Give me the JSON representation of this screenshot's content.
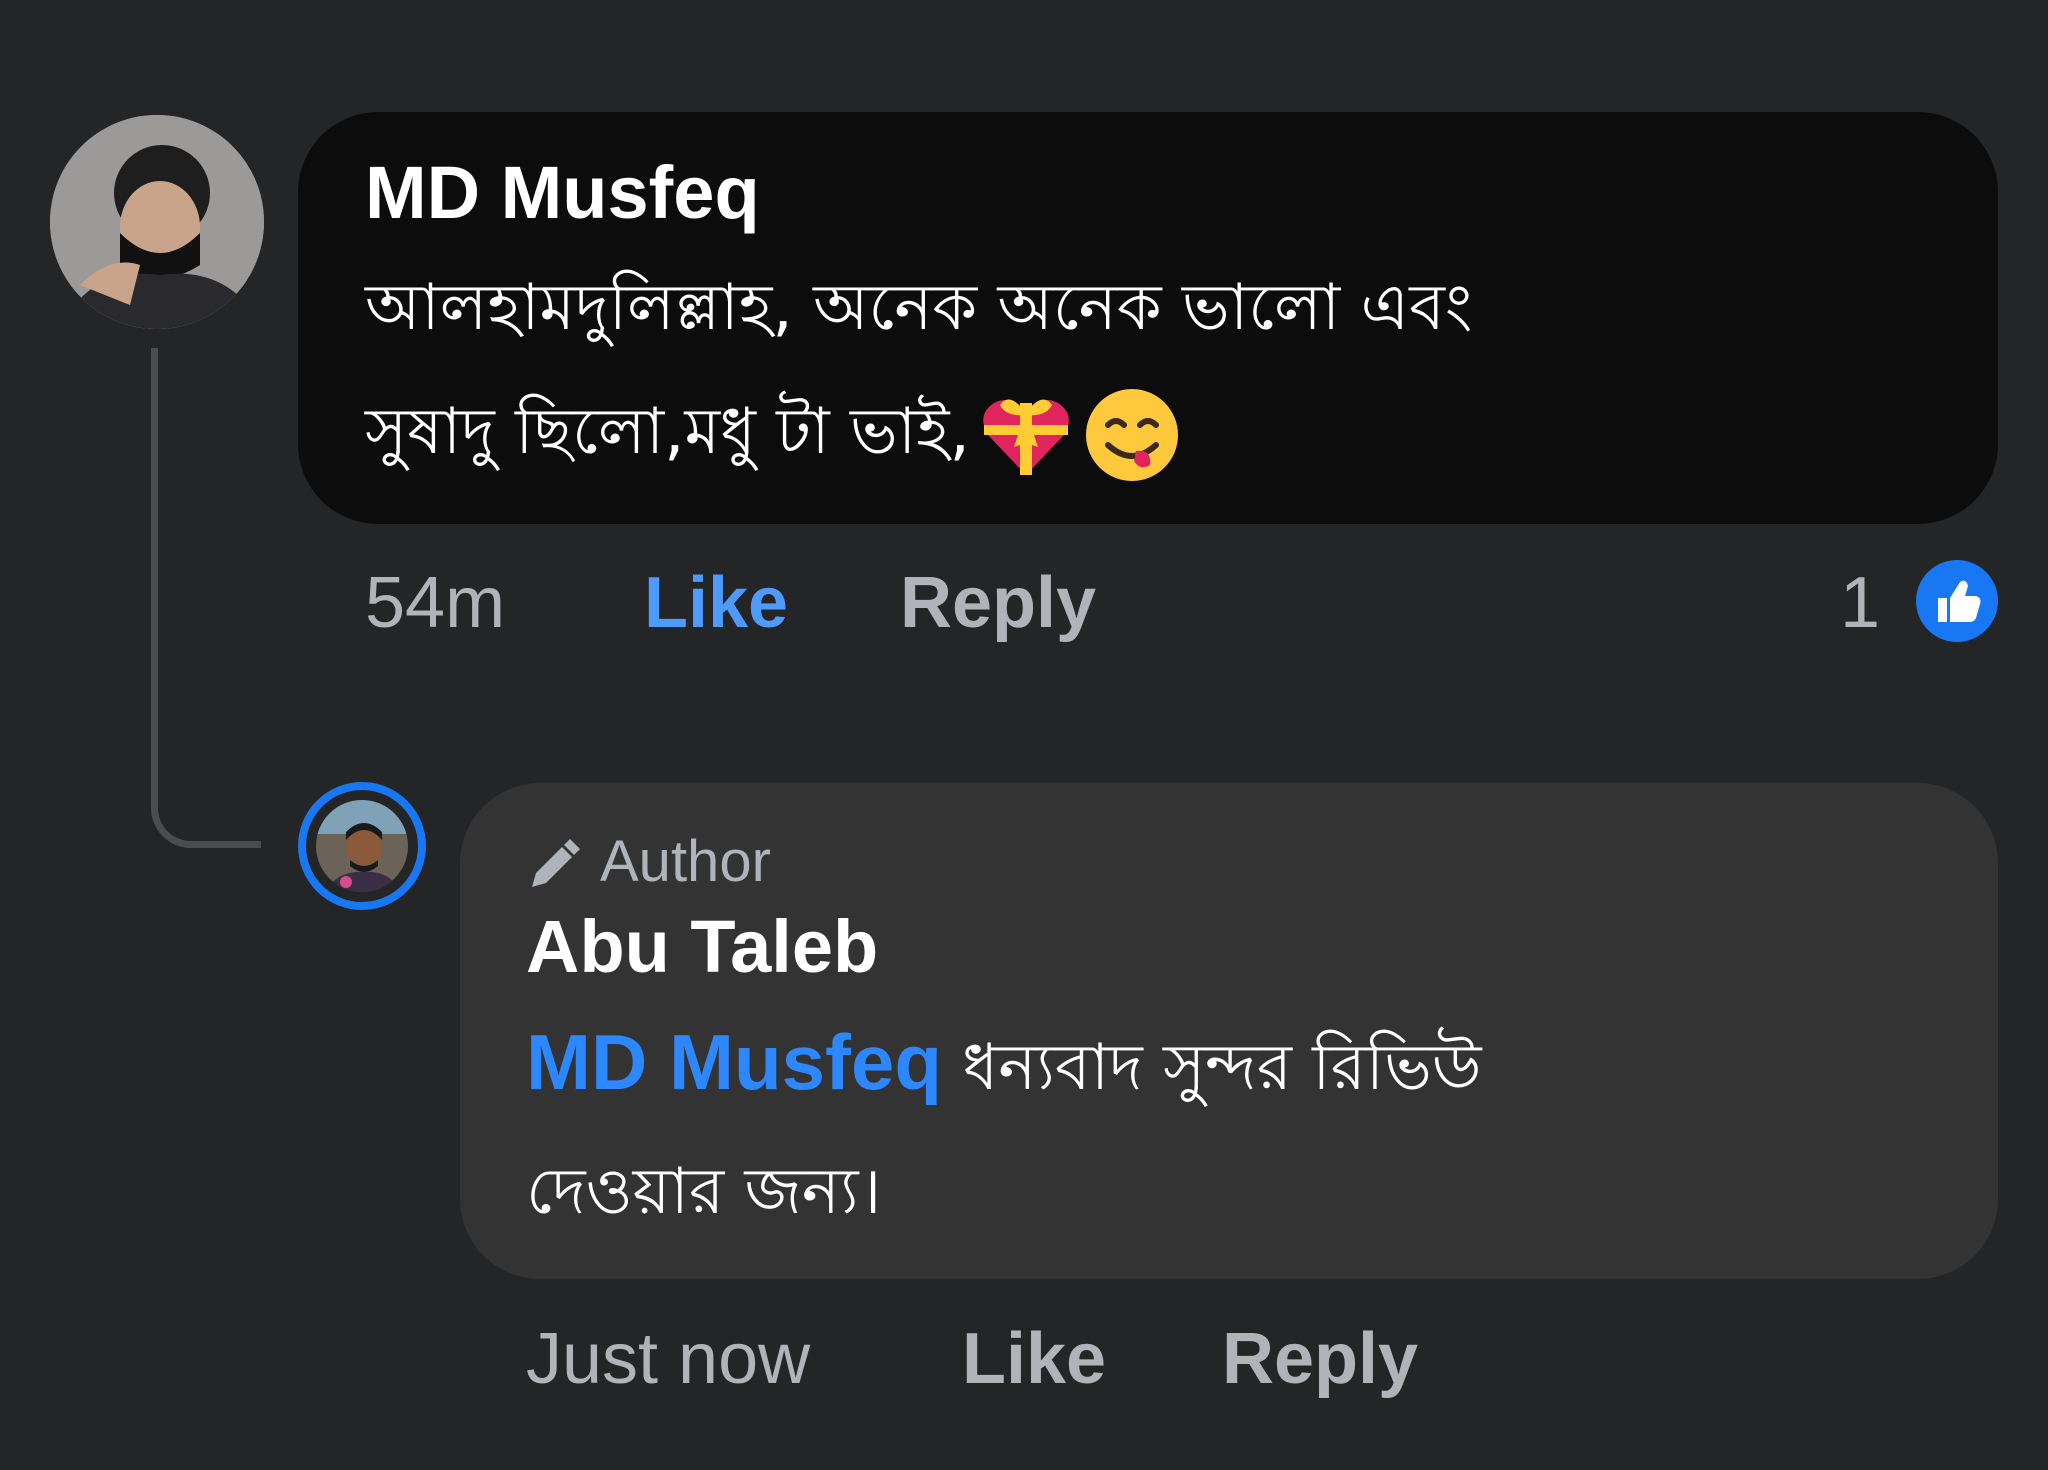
{
  "main_comment": {
    "author": "MD Musfeq",
    "text_line1": "আলহামদুলিল্লাহ, অনেক অনেক ভালো এবং",
    "text_line2": "সুষাদু ছিলো,মধু টা ভাই,",
    "emojis": [
      "gift-heart-icon",
      "savoring-food-face-icon"
    ],
    "time": "54m",
    "like_label": "Like",
    "reply_label": "Reply",
    "reaction_count": "1",
    "reaction_icon": "thumbs-up-icon"
  },
  "reply_comment": {
    "badge_label": "Author",
    "badge_icon": "pencil-icon",
    "author": "Abu Taleb",
    "mention": "MD Musfeq",
    "text_line1": "ধন্যবাদ সুন্দর রিভিউ",
    "text_line2": "দেওয়ার জন্য।",
    "time": "Just now",
    "like_label": "Like",
    "reply_label": "Reply"
  },
  "colors": {
    "background": "#242526",
    "main_bubble": "#0c0c0c",
    "reply_bubble": "#333334",
    "accent": "#1877f2",
    "mention": "#2d88ff",
    "secondary_text": "#b0b3b8"
  }
}
